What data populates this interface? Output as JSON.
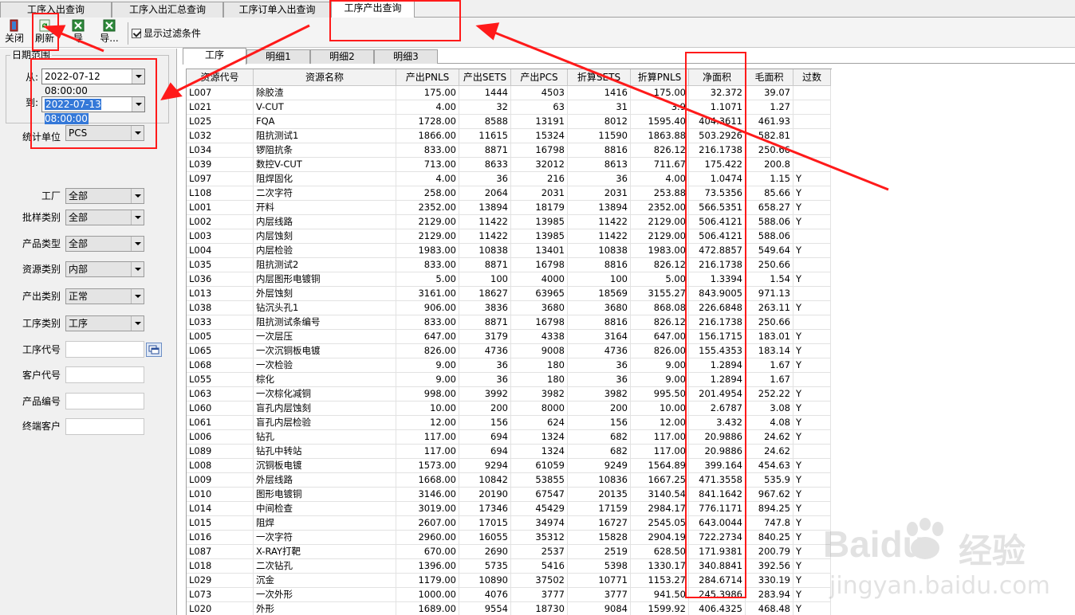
{
  "top_tabs": [
    "工序入出查询",
    "工序入出汇总查询",
    "工序订单入出查询",
    "工序产出查询"
  ],
  "toolbar": {
    "close_label": "关闭",
    "refresh_label": "刷新",
    "export1_label": "导",
    "export2_label": "导...",
    "show_filter_label": "显示过滤条件"
  },
  "filters": {
    "date_group_title": "日期范围",
    "from_label": "从:",
    "from_value": "2022-07-12 08:00:00",
    "to_label": "到:",
    "to_value": "2022-07-13 08:00:00",
    "unit_label": "统计单位",
    "unit_value": "PCS",
    "factory_label": "工厂",
    "factory_value": "全部",
    "sample_label": "批样类别",
    "sample_value": "全部",
    "product_type_label": "产品类型",
    "product_type_value": "全部",
    "resource_type_label": "资源类别",
    "resource_type_value": "内部",
    "output_type_label": "产出类别",
    "output_type_value": "正常",
    "process_type_label": "工序类别",
    "process_type_value": "工序",
    "process_code_label": "工序代号",
    "customer_code_label": "客户代号",
    "product_no_label": "产品编号",
    "end_customer_label": "终端客户"
  },
  "sub_tabs": [
    "工序",
    "明细1",
    "明细2",
    "明细3"
  ],
  "table": {
    "headers": [
      "资源代号",
      "资源名称",
      "产出PNLS",
      "产出SETS",
      "产出PCS",
      "折算SETS",
      "折算PNLS",
      "净面积",
      "毛面积",
      "过数"
    ],
    "rows": [
      [
        "L007",
        "除胶渣",
        "175.00",
        "1444",
        "4503",
        "1416",
        "175.00",
        "32.372",
        "39.07",
        ""
      ],
      [
        "L021",
        "V-CUT",
        "4.00",
        "32",
        "63",
        "31",
        "3.9",
        "1.1071",
        "1.27",
        ""
      ],
      [
        "L025",
        "FQA",
        "1728.00",
        "8588",
        "13191",
        "8012",
        "1595.40",
        "404.3611",
        "461.93",
        ""
      ],
      [
        "L032",
        "阻抗测试1",
        "1866.00",
        "11615",
        "15324",
        "11590",
        "1863.88",
        "503.2926",
        "582.81",
        ""
      ],
      [
        "L034",
        "锣阻抗条",
        "833.00",
        "8871",
        "16798",
        "8816",
        "826.12",
        "216.1738",
        "250.66",
        ""
      ],
      [
        "L039",
        "数控V-CUT",
        "713.00",
        "8633",
        "32012",
        "8613",
        "711.67",
        "175.422",
        "200.8",
        ""
      ],
      [
        "L097",
        "阻焊固化",
        "4.00",
        "36",
        "216",
        "36",
        "4.00",
        "1.0474",
        "1.15",
        "Y"
      ],
      [
        "L108",
        "二次字符",
        "258.00",
        "2064",
        "2031",
        "2031",
        "253.88",
        "73.5356",
        "85.66",
        "Y"
      ],
      [
        "L001",
        "开料",
        "2352.00",
        "13894",
        "18179",
        "13894",
        "2352.00",
        "566.5351",
        "658.27",
        "Y"
      ],
      [
        "L002",
        "内层线路",
        "2129.00",
        "11422",
        "13985",
        "11422",
        "2129.00",
        "506.4121",
        "588.06",
        "Y"
      ],
      [
        "L003",
        "内层蚀刻",
        "2129.00",
        "11422",
        "13985",
        "11422",
        "2129.00",
        "506.4121",
        "588.06",
        ""
      ],
      [
        "L004",
        "内层检验",
        "1983.00",
        "10838",
        "13401",
        "10838",
        "1983.00",
        "472.8857",
        "549.64",
        "Y"
      ],
      [
        "L035",
        "阻抗测试2",
        "833.00",
        "8871",
        "16798",
        "8816",
        "826.12",
        "216.1738",
        "250.66",
        ""
      ],
      [
        "L036",
        "内层图形电镀铜",
        "5.00",
        "100",
        "4000",
        "100",
        "5.00",
        "1.3394",
        "1.54",
        "Y"
      ],
      [
        "L013",
        "外层蚀刻",
        "3161.00",
        "18627",
        "63965",
        "18569",
        "3155.27",
        "843.9005",
        "971.13",
        ""
      ],
      [
        "L038",
        "钻沉头孔1",
        "906.00",
        "3836",
        "3680",
        "3680",
        "868.08",
        "226.6848",
        "263.11",
        "Y"
      ],
      [
        "L033",
        "阻抗测试条编号",
        "833.00",
        "8871",
        "16798",
        "8816",
        "826.12",
        "216.1738",
        "250.66",
        ""
      ],
      [
        "L005",
        "一次层压",
        "647.00",
        "3179",
        "4338",
        "3164",
        "647.00",
        "156.1715",
        "183.01",
        "Y"
      ],
      [
        "L065",
        "一次沉铜板电镀",
        "826.00",
        "4736",
        "9008",
        "4736",
        "826.00",
        "155.4353",
        "183.14",
        "Y"
      ],
      [
        "L068",
        "一次检验",
        "9.00",
        "36",
        "180",
        "36",
        "9.00",
        "1.2894",
        "1.67",
        "Y"
      ],
      [
        "L055",
        "棕化",
        "9.00",
        "36",
        "180",
        "36",
        "9.00",
        "1.2894",
        "1.67",
        ""
      ],
      [
        "L063",
        "一次棕化减铜",
        "998.00",
        "3992",
        "3982",
        "3982",
        "995.50",
        "201.4954",
        "252.22",
        "Y"
      ],
      [
        "L060",
        "盲孔内层蚀刻",
        "10.00",
        "200",
        "8000",
        "200",
        "10.00",
        "2.6787",
        "3.08",
        "Y"
      ],
      [
        "L061",
        "盲孔内层检验",
        "12.00",
        "156",
        "624",
        "156",
        "12.00",
        "3.432",
        "4.08",
        "Y"
      ],
      [
        "L006",
        "钻孔",
        "117.00",
        "694",
        "1324",
        "682",
        "117.00",
        "20.9886",
        "24.62",
        "Y"
      ],
      [
        "L089",
        "钻孔中转站",
        "117.00",
        "694",
        "1324",
        "682",
        "117.00",
        "20.9886",
        "24.62",
        ""
      ],
      [
        "L008",
        "沉铜板电镀",
        "1573.00",
        "9294",
        "61059",
        "9249",
        "1564.89",
        "399.164",
        "454.63",
        "Y"
      ],
      [
        "L009",
        "外层线路",
        "1668.00",
        "10842",
        "53855",
        "10836",
        "1667.25",
        "471.3558",
        "535.9",
        "Y"
      ],
      [
        "L010",
        "图形电镀铜",
        "3146.00",
        "20190",
        "67547",
        "20135",
        "3140.54",
        "841.1642",
        "967.62",
        "Y"
      ],
      [
        "L014",
        "中间检查",
        "3019.00",
        "17346",
        "45429",
        "17159",
        "2984.17",
        "776.1171",
        "894.25",
        "Y"
      ],
      [
        "L015",
        "阻焊",
        "2607.00",
        "17015",
        "34974",
        "16727",
        "2545.05",
        "643.0044",
        "747.8",
        "Y"
      ],
      [
        "L016",
        "一次字符",
        "2960.00",
        "16055",
        "35312",
        "15828",
        "2904.19",
        "722.2734",
        "840.25",
        "Y"
      ],
      [
        "L087",
        "X-RAY打靶",
        "670.00",
        "2690",
        "2537",
        "2519",
        "628.50",
        "171.9381",
        "200.79",
        "Y"
      ],
      [
        "L018",
        "二次钻孔",
        "1396.00",
        "5735",
        "5416",
        "5398",
        "1330.17",
        "340.8841",
        "392.56",
        "Y"
      ],
      [
        "L029",
        "沉金",
        "1179.00",
        "10890",
        "37502",
        "10771",
        "1153.27",
        "284.6714",
        "330.19",
        "Y"
      ],
      [
        "L073",
        "一次外形",
        "1000.00",
        "4076",
        "3777",
        "3777",
        "941.50",
        "245.3986",
        "283.94",
        "Y"
      ],
      [
        "L020",
        "外形",
        "1689.00",
        "9554",
        "18730",
        "9084",
        "1599.92",
        "406.4325",
        "468.48",
        "Y"
      ]
    ]
  },
  "watermark": {
    "brand": "Baidu",
    "cn": "经验",
    "url": "jingyan.baidu.com"
  },
  "colors": {
    "annotation_red": "#ff1a1a",
    "selection_blue": "#3478d8"
  }
}
